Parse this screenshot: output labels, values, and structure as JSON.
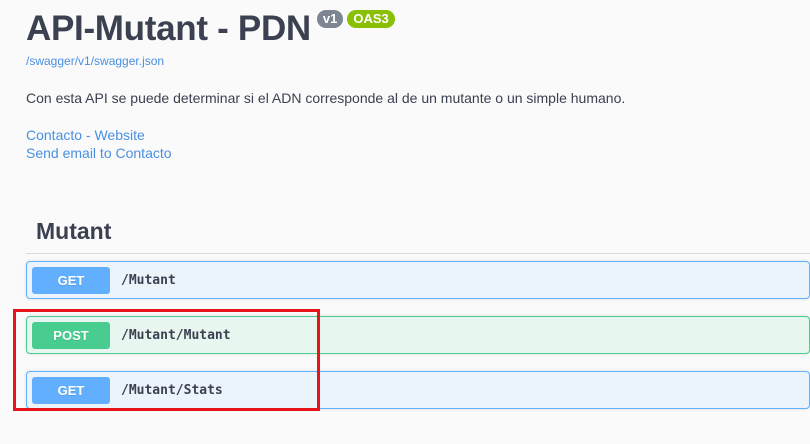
{
  "info": {
    "title": "API-Mutant - PDN",
    "version_badge": "v1",
    "oas_badge": "OAS3",
    "spec_url": "/swagger/v1/swagger.json",
    "description": "Con esta API se puede determinar si el ADN corresponde al de un mutante o un simple humano.",
    "contact_link": "Contacto - Website",
    "email_link": "Send email to Contacto"
  },
  "tag": {
    "name": "Mutant",
    "operations": [
      {
        "method": "GET",
        "path": "/Mutant"
      },
      {
        "method": "POST",
        "path": "/Mutant/Mutant"
      },
      {
        "method": "GET",
        "path": "/Mutant/Stats"
      }
    ]
  },
  "colors": {
    "get": "#61affe",
    "post": "#49cc90",
    "link": "#4990e2",
    "highlight": "#e8141c"
  }
}
